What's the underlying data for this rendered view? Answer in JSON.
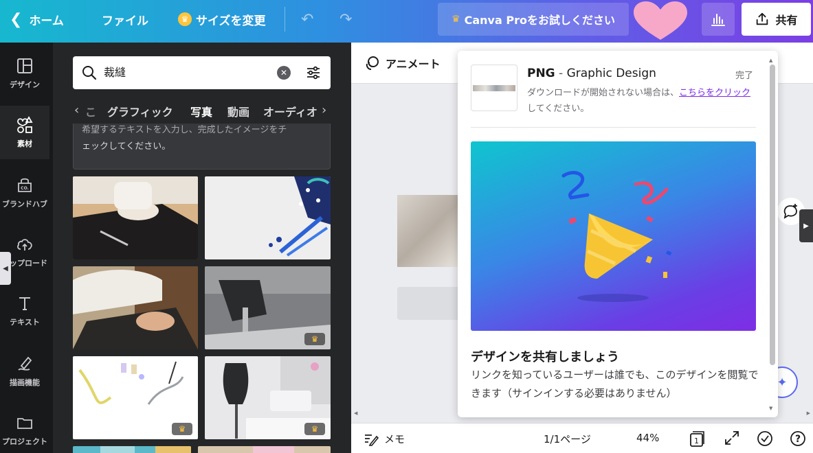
{
  "topbar": {
    "home": "ホーム",
    "file": "ファイル",
    "resize": "サイズを変更",
    "pro": "Canva Proをお試しください",
    "share": "共有"
  },
  "sidebar": {
    "items": [
      {
        "label": "デザイン",
        "icon": "layout-icon"
      },
      {
        "label": "素材",
        "icon": "elements-icon"
      },
      {
        "label": "ブランドハブ",
        "icon": "brand-hub-icon"
      },
      {
        "label": "アップロード",
        "icon": "upload-cloud-icon"
      },
      {
        "label": "テキスト",
        "icon": "text-icon"
      },
      {
        "label": "描画機能",
        "icon": "draw-icon"
      },
      {
        "label": "プロジェクト",
        "icon": "folder-icon"
      }
    ]
  },
  "panel": {
    "search": {
      "value": "裁縫"
    },
    "tabs": [
      "グラフィック",
      "写真",
      "動画",
      "オーディオ"
    ],
    "tab_prev_partial": "こ",
    "info": {
      "line1": "希望するテキストを入力し、完成したイメージをチ",
      "line2": "ェックしてください。"
    }
  },
  "editor": {
    "animate": "アニメート",
    "memo": "メモ",
    "page": "1/1ページ",
    "zoom": "44%",
    "page_count": "1"
  },
  "popup": {
    "format": "PNG",
    "dash": " - ",
    "design_name": "Graphic Design",
    "done": "完了",
    "msg_before": "ダウンロードが開始されない場合は、",
    "msg_link": "こちらをクリック",
    "msg_after": "してください。",
    "heading": "デザインを共有しましょう",
    "body": "リンクを知っているユーザーは誰でも、このデザインを閲覧できます（サインインする必要はありません）"
  },
  "colors": {
    "accent": "#7d2ae8",
    "panel_bg": "#252627",
    "sidebar_bg": "#18191b",
    "crown": "#ffc53d"
  }
}
